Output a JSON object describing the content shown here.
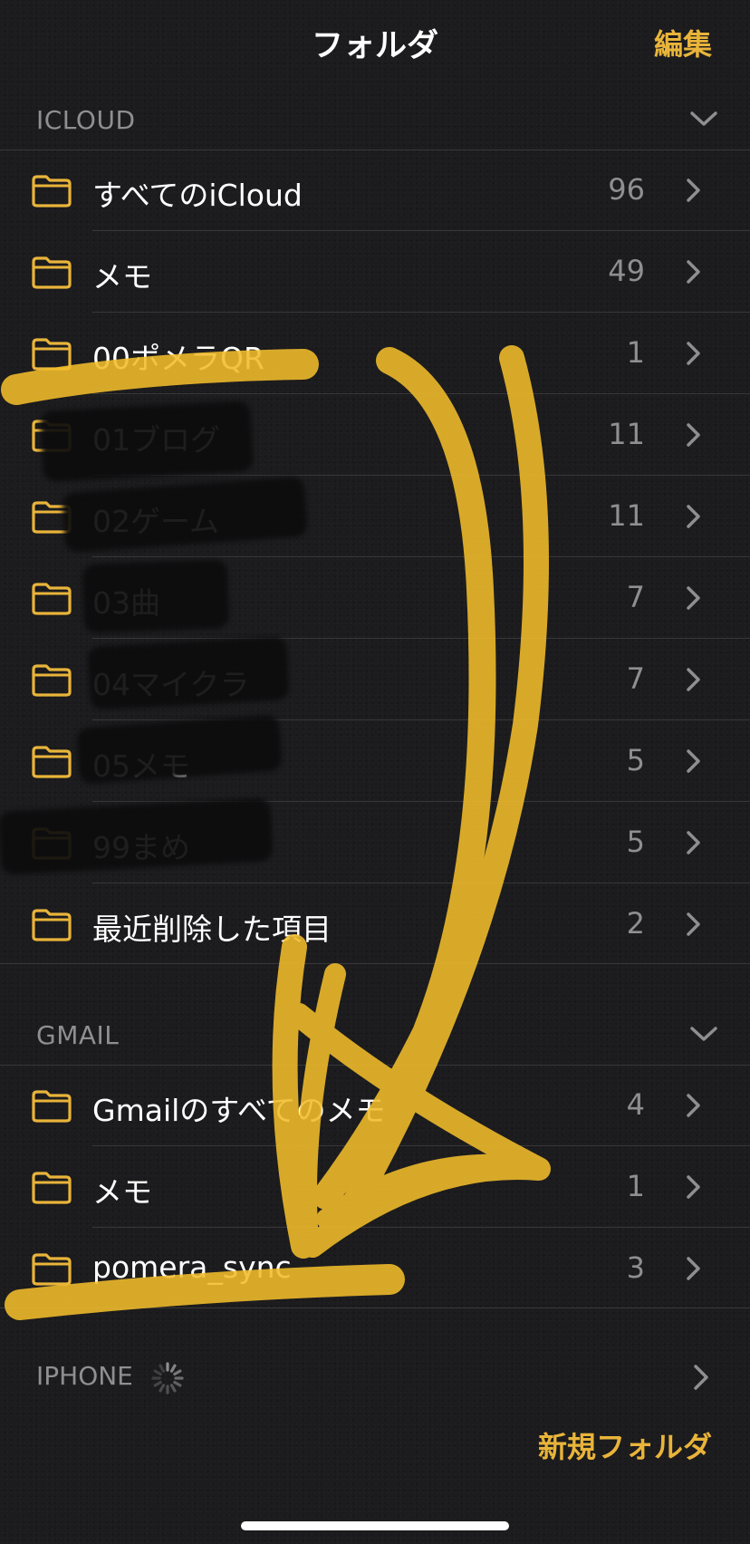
{
  "nav": {
    "title": "フォルダ",
    "edit_label": "編集"
  },
  "icloud": {
    "header": "ICLOUD",
    "rows": [
      {
        "label": "すべてのiCloud",
        "count": "96"
      },
      {
        "label": "メモ",
        "count": "49"
      },
      {
        "label": "00ポメラQR",
        "count": "1"
      },
      {
        "label": "01ブログ",
        "count": "11"
      },
      {
        "label": "02ゲーム",
        "count": "11"
      },
      {
        "label": "03曲",
        "count": "7"
      },
      {
        "label": "04マイクラ",
        "count": "7"
      },
      {
        "label": "05メモ",
        "count": "5"
      },
      {
        "label": "99まめ",
        "count": "5"
      },
      {
        "label": "最近削除した項目",
        "count": "2"
      }
    ]
  },
  "gmail": {
    "header": "GMAIL",
    "rows": [
      {
        "label": "Gmailのすべてのメモ",
        "count": "4"
      },
      {
        "label": "メモ",
        "count": "1"
      },
      {
        "label": "pomera_sync",
        "count": "3"
      }
    ]
  },
  "iphone": {
    "header": "IPHONE"
  },
  "footer": {
    "new_folder_label": "新規フォルダ"
  },
  "colors": {
    "accent": "#e9b43a",
    "highlighter": "#f2bd2b",
    "background": "#1c1c1e"
  },
  "icons": {
    "folder": "folder-icon",
    "chevron_right": "chevron-right-icon",
    "chevron_down": "chevron-down-icon",
    "spinner": "loading-spinner-icon"
  }
}
